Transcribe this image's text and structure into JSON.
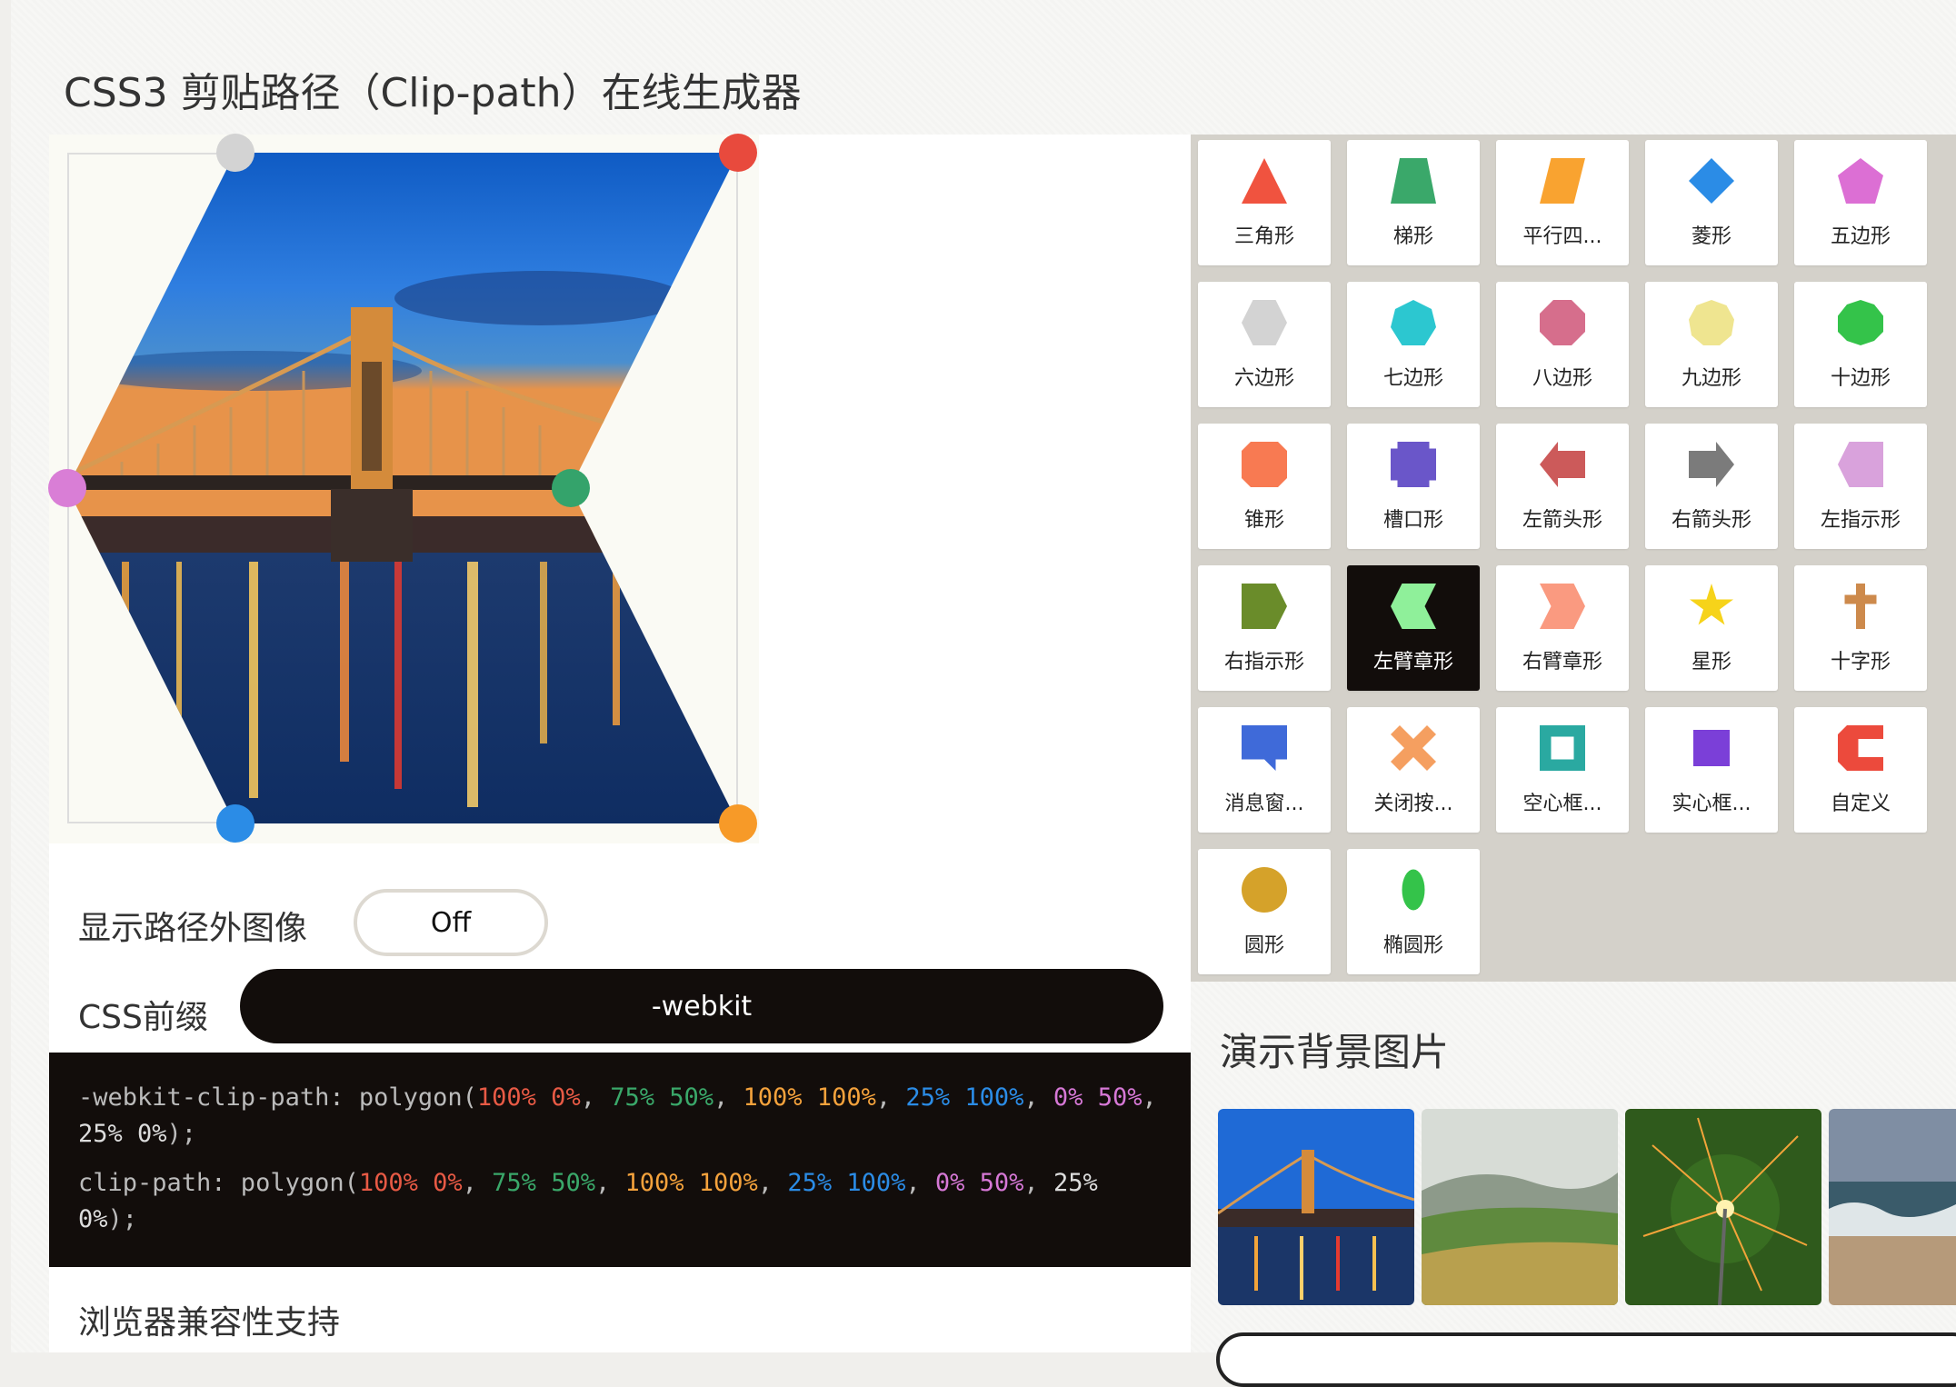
{
  "title": "CSS3 剪贴路径（Clip-path）在线生成器",
  "show_outside": {
    "label": "显示路径外图像",
    "toggle": "Off"
  },
  "prefix": {
    "label": "CSS前缀",
    "value": "-webkit"
  },
  "code": {
    "webkit": {
      "prop": "-webkit-clip-path: polygon(",
      "p1": "100% 0%",
      "p2": "75% 50%",
      "p3": "100% 100%",
      "p4": "25% 100%",
      "p5": "0% 50%",
      "p6": "25% 0%",
      "end": ");"
    },
    "standard": {
      "prop": "clip-path: polygon(",
      "p1": "100% 0%",
      "p2": "75% 50%",
      "p3": "100% 100%",
      "p4": "25% 100%",
      "p5": "0% 50%",
      "p6": "25% 0%",
      "end": ");"
    },
    "colors": [
      "#e85a45",
      "#3aa86a",
      "#f4a23c",
      "#2b8ce6",
      "#d678d6",
      "#bbbbbb"
    ]
  },
  "browser_support": "浏览器兼容性支持",
  "shapes": [
    {
      "label": "三角形",
      "icon": "triangle-icon",
      "color": "#f0533f",
      "clip": "polygon(50% 0%, 0% 100%, 100% 100%)"
    },
    {
      "label": "梯形",
      "icon": "trapezoid-icon",
      "color": "#3aa86a",
      "clip": "polygon(20% 0%, 80% 0%, 100% 100%, 0% 100%)"
    },
    {
      "label": "平行四...",
      "icon": "parallelogram-icon",
      "color": "#f9a330",
      "clip": "polygon(25% 0%, 100% 0%, 75% 100%, 0% 100%)"
    },
    {
      "label": "菱形",
      "icon": "rhombus-icon",
      "color": "#2b8ce6",
      "clip": "polygon(50% 0%, 100% 50%, 50% 100%, 0% 50%)"
    },
    {
      "label": "五边形",
      "icon": "pentagon-icon",
      "color": "#dc6fd4",
      "clip": "polygon(50% 0%, 100% 38%, 82% 100%, 18% 100%, 0% 38%)"
    },
    {
      "label": "六边形",
      "icon": "hexagon-icon",
      "color": "#d3d3d3",
      "clip": "polygon(25% 0%, 75% 0%, 100% 50%, 75% 100%, 25% 100%, 0% 50%)"
    },
    {
      "label": "七边形",
      "icon": "heptagon-icon",
      "color": "#2cc7d0",
      "clip": "polygon(50% 0%, 90% 20%, 100% 60%, 75% 100%, 25% 100%, 0% 60%, 10% 20%)"
    },
    {
      "label": "八边形",
      "icon": "octagon-icon",
      "color": "#d66e8c",
      "clip": "polygon(30% 0%, 70% 0%, 100% 30%, 100% 70%, 70% 100%, 30% 100%, 0% 70%, 0% 30%)"
    },
    {
      "label": "九边形",
      "icon": "nonagon-icon",
      "color": "#efe590",
      "clip": "polygon(50% 0%, 83% 12%, 100% 43%, 94% 78%, 68% 100%, 32% 100%, 6% 78%, 0% 43%, 17% 12%)"
    },
    {
      "label": "十边形",
      "icon": "decagon-icon",
      "color": "#34c34a",
      "clip": "polygon(50% 0%, 80% 10%, 100% 35%, 100% 70%, 80% 90%, 50% 100%, 20% 90%, 0% 70%, 0% 35%, 20% 10%)"
    },
    {
      "label": "锥形",
      "icon": "bevel-icon",
      "color": "#f87a52",
      "clip": "polygon(20% 0%, 80% 0%, 100% 20%, 100% 80%, 80% 100%, 20% 100%, 0% 80%, 0% 20%)"
    },
    {
      "label": "槽口形",
      "icon": "rabbet-icon",
      "color": "#6a56c9",
      "clip": "polygon(0% 15%, 15% 15%, 15% 0%, 85% 0%, 85% 15%, 100% 15%, 100% 85%, 85% 85%, 85% 100%, 15% 100%, 15% 85%, 0% 85%)"
    },
    {
      "label": "左箭头形",
      "icon": "left-arrow-icon",
      "color": "#cc5a5a",
      "clip": "polygon(40% 0%, 40% 20%, 100% 20%, 100% 80%, 40% 80%, 40% 100%, 0% 50%)"
    },
    {
      "label": "右箭头形",
      "icon": "right-arrow-icon",
      "color": "#7b7b7b",
      "clip": "polygon(0% 20%, 60% 20%, 60% 0%, 100% 50%, 60% 100%, 60% 80%, 0% 80%)"
    },
    {
      "label": "左指示形",
      "icon": "left-point-icon",
      "color": "#d9a2dc",
      "clip": "polygon(25% 0%, 100% 0%, 100% 100%, 25% 100%, 0% 50%)"
    },
    {
      "label": "右指示形",
      "icon": "right-point-icon",
      "color": "#6a8c2a",
      "clip": "polygon(0% 0%, 75% 0%, 100% 50%, 75% 100%, 0% 100%)"
    },
    {
      "label": "左臂章形",
      "icon": "left-chevron-icon",
      "color": "#8ff09a",
      "clip": "polygon(100% 0%, 75% 50%, 100% 100%, 25% 100%, 0% 50%, 25% 0%)"
    },
    {
      "label": "右臂章形",
      "icon": "right-chevron-icon",
      "color": "#fa9a80",
      "clip": "polygon(75% 0%, 100% 50%, 75% 100%, 0% 100%, 25% 50%, 0% 0%)"
    },
    {
      "label": "星形",
      "icon": "star-icon",
      "color": "#f6d31a",
      "clip": "polygon(50% 0%, 61% 35%, 98% 35%, 68% 57%, 79% 91%, 50% 70%, 21% 91%, 32% 57%, 2% 35%, 39% 35%)"
    },
    {
      "label": "十字形",
      "icon": "cross-icon",
      "color": "#cd8a4c",
      "clip": "polygon(40% 0%, 60% 0%, 60% 25%, 85% 25%, 85% 45%, 60% 45%, 60% 100%, 40% 100%, 40% 45%, 15% 45%, 15% 25%, 40% 25%)"
    },
    {
      "label": "消息窗...",
      "icon": "message-icon",
      "color": "#3f6ad9",
      "clip": "polygon(0% 0%, 100% 0%, 100% 75%, 75% 75%, 75% 100%, 50% 75%, 0% 75%)"
    },
    {
      "label": "关闭按...",
      "icon": "close-icon",
      "color": "#f59f60",
      "clip": "polygon(20% 0%, 50% 30%, 80% 0%, 100% 20%, 70% 50%, 100% 80%, 80% 100%, 50% 70%, 20% 100%, 0% 80%, 30% 50%, 0% 20%)"
    },
    {
      "label": "空心框...",
      "icon": "frame-icon",
      "color": "#2aa9a1",
      "clip": "polygon(0% 0%, 0% 100%, 25% 100%, 25% 25%, 75% 25%, 75% 75%, 25% 75%, 25% 100%, 100% 100%, 100% 0%)"
    },
    {
      "label": "实心框...",
      "icon": "solid-frame-icon",
      "color": "#7b3fd8",
      "clip": "polygon(10% 10%, 90% 10%, 90% 90%, 10% 90%)"
    },
    {
      "label": "自定义",
      "icon": "custom-icon",
      "color": "#ec4a3c",
      "clip": "polygon(20% 0%, 100% 0%, 100% 30%, 45% 30%, 45% 70%, 100% 70%, 100% 100%, 20% 100%, 0% 80%, 0% 20%)"
    },
    {
      "label": "圆形",
      "icon": "circle-icon",
      "color": "#d5a22a",
      "clip": "circle(50% at 50% 50%)"
    },
    {
      "label": "椭圆形",
      "icon": "ellipse-icon",
      "color": "#34c34a",
      "clip": "ellipse(25% 45% at 50% 50%)"
    }
  ],
  "selected_shape": "左臂章形",
  "demo_title": "演示背景图片",
  "thumbnails": [
    "bridge-night-thumbnail",
    "green-hills-thumbnail",
    "sparkler-thumbnail",
    "sea-waves-thumbnail"
  ],
  "handle_colors": [
    "#e84a3d",
    "#2b8ce6",
    "#f79a28",
    "#d3d3d3",
    "#d97ed6",
    "#34a36b"
  ]
}
